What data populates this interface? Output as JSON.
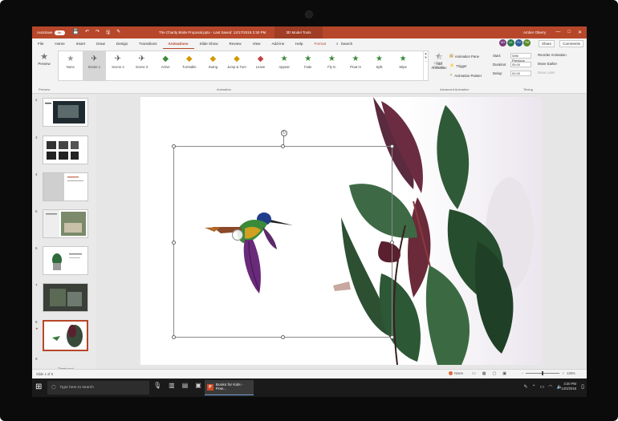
{
  "titlebar": {
    "autosave_label": "AutoSave",
    "autosave_state": "On",
    "qat": [
      "💾",
      "↶",
      "↷",
      "🖫",
      "✎"
    ],
    "doc_title": "The Charity Bride Proposal.pptx - Last Saved: 12/17/2018 2:30 PM",
    "context_tab": "3D Model Tools",
    "user_name": "Amber Oberry",
    "controls": [
      "—",
      "□",
      "✕"
    ]
  },
  "tabs": {
    "items": [
      "File",
      "Home",
      "Insert",
      "Draw",
      "Design",
      "Transitions",
      "Animations",
      "Slide Show",
      "Review",
      "View",
      "Add-ins",
      "Help"
    ],
    "active_index": 6,
    "format": "Format",
    "search": "Search",
    "share": "Share",
    "comments": "Comments",
    "presence": [
      {
        "initials": "AO",
        "color": "#7a3a7a"
      },
      {
        "initials": "LK",
        "color": "#2a7a4a"
      },
      {
        "initials": "RJ",
        "color": "#2a5a9a"
      },
      {
        "initials": "TM",
        "color": "#5a8a2a"
      }
    ]
  },
  "ribbon": {
    "preview": {
      "label": "Preview",
      "icon": "★"
    },
    "animations": [
      {
        "label": "None",
        "glyph": "★",
        "color": "#999"
      },
      {
        "label": "Scene 1",
        "glyph": "✈",
        "color": "#555"
      },
      {
        "label": "Scene 2",
        "glyph": "✈",
        "color": "#555"
      },
      {
        "label": "Scene 3",
        "glyph": "✈",
        "color": "#555"
      },
      {
        "label": "Arrive",
        "glyph": "◆",
        "color": "#3c8a3c"
      },
      {
        "label": "Turntable",
        "glyph": "◆",
        "color": "#d19a00"
      },
      {
        "label": "Swing",
        "glyph": "◆",
        "color": "#d19a00"
      },
      {
        "label": "Jump & Turn",
        "glyph": "◆",
        "color": "#d19a00"
      },
      {
        "label": "Leave",
        "glyph": "◆",
        "color": "#c24040"
      },
      {
        "label": "Appear",
        "glyph": "★",
        "color": "#3c8a3c"
      },
      {
        "label": "Fade",
        "glyph": "★",
        "color": "#3c8a3c"
      },
      {
        "label": "Fly In",
        "glyph": "★",
        "color": "#3c8a3c"
      },
      {
        "label": "Float In",
        "glyph": "★",
        "color": "#3c8a3c"
      },
      {
        "label": "Split",
        "glyph": "★",
        "color": "#3c8a3c"
      },
      {
        "label": "Wipe",
        "glyph": "★",
        "color": "#3c8a3c"
      }
    ],
    "selected_animation": 1,
    "effect_options": "Effect Options",
    "add_animation": "Add Animation",
    "advanced": [
      "Animation Pane",
      "Trigger",
      "Animation Painter"
    ],
    "timing": {
      "start_label": "Start:",
      "start_value": "With Previous",
      "duration_label": "Duration:",
      "duration_value": "05.00",
      "delay_label": "Delay:",
      "delay_value": "00.00"
    },
    "reorder": {
      "title": "Reorder Animation",
      "earlier": "Move Earlier",
      "later": "Move Later"
    },
    "groups": {
      "preview": "Preview",
      "animation": "Animation",
      "advanced": "Advanced Animation",
      "timing": "Timing"
    }
  },
  "thumbnails": {
    "numbers": [
      "2",
      "3",
      "4",
      "5",
      "6",
      "7",
      "8"
    ],
    "selected": 6,
    "tooltip": "Thank you!"
  },
  "status": {
    "slide_count": "Slide 1 of 8",
    "notes": "Notes",
    "zoom": "136%"
  },
  "taskbar": {
    "search_placeholder": "Type here to search",
    "app_label": "Books for Kids - Pow...",
    "time": "3:30 PM",
    "date": "12/3/2018"
  },
  "colors": {
    "accent": "#b7472a",
    "taskbar": "#1a1a1a"
  }
}
